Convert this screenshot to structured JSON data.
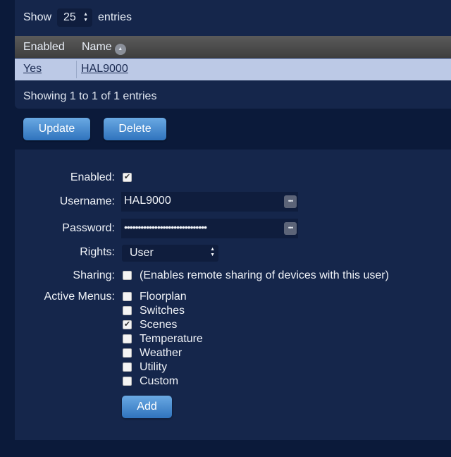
{
  "table": {
    "show_label": "Show",
    "length_value": "25",
    "entries_label": "entries",
    "columns": [
      "Enabled",
      "Name"
    ],
    "rows": [
      {
        "enabled": "Yes",
        "name": "HAL9000"
      }
    ],
    "info": "Showing 1 to 1 of 1 entries"
  },
  "actions": {
    "update_label": "Update",
    "delete_label": "Delete"
  },
  "form": {
    "enabled_label": "Enabled:",
    "enabled_checked": true,
    "username_label": "Username:",
    "username_value": "HAL9000",
    "password_label": "Password:",
    "password_value": "••••••••••••••••••••••••••••••",
    "rights_label": "Rights:",
    "rights_value": "User",
    "sharing_label": "Sharing:",
    "sharing_checked": false,
    "sharing_note": "(Enables remote sharing of devices with this user)",
    "menus_label": "Active Menus:",
    "menus": [
      {
        "label": "Floorplan",
        "checked": false
      },
      {
        "label": "Switches",
        "checked": false
      },
      {
        "label": "Scenes",
        "checked": true
      },
      {
        "label": "Temperature",
        "checked": false
      },
      {
        "label": "Weather",
        "checked": false
      },
      {
        "label": "Utility",
        "checked": false
      },
      {
        "label": "Custom",
        "checked": false
      }
    ],
    "add_label": "Add"
  },
  "icons": {
    "sort": "sort-ascending-icon",
    "field_menu": "ellipsis-icon",
    "select_arrows": "up-down-arrows-icon",
    "check": "checkmark-icon"
  },
  "colors": {
    "page_bg": "#0b1a3a",
    "panel_bg": "#15264b",
    "selected_row": "#bcc9e6",
    "button": "#3f86cf"
  }
}
